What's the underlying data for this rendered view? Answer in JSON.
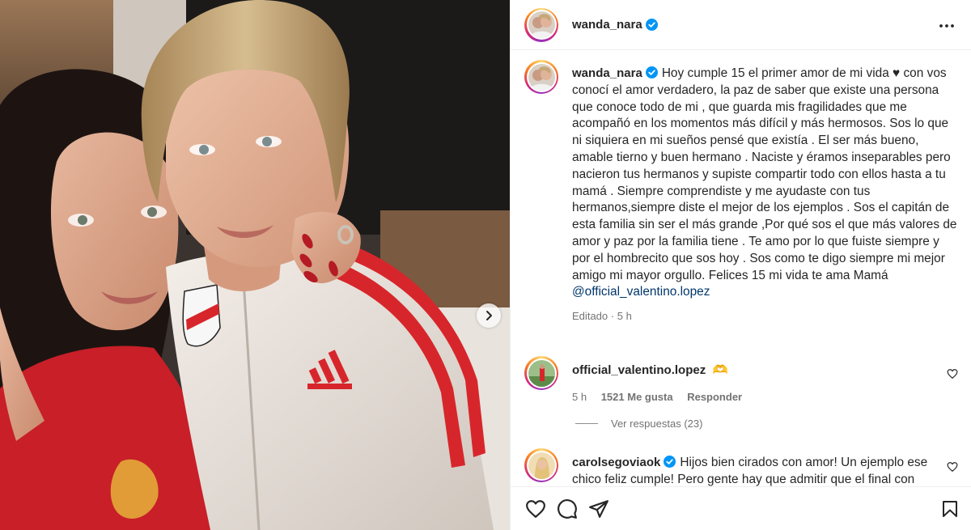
{
  "post": {
    "username": "wanda_nara",
    "caption": "Hoy cumple 15 el primer amor de mi vida ♥ con vos conocí el amor verdadero, la paz de saber que existe una persona que conoce todo de mi , que guarda mis fragilidades que me acompañó en los momentos más difícil y más hermosos. Sos lo que ni siquiera en mi sueños pensé que existía . El ser más bueno, amable tierno y buen hermano . Naciste y éramos inseparables pero nacieron tus hermanos y supiste compartir todo con ellos hasta a tu mamá . Siempre comprendiste y me ayudaste con tus hermanos,siempre diste el mejor de los ejemplos . Sos el capitán de esta familia sin ser el más grande ,Por qué sos el que más valores de amor y paz por la familia tiene . Te amo por lo que fuiste siempre y por el hombrecito que sos hoy . Sos como te digo siempre mi mejor amigo mi mayor orgullo. Felices 15 mi vida te ama Mamá",
    "mention": "@official_valentino.lopez",
    "edited": "Editado",
    "time": "5 h"
  },
  "comments": [
    {
      "username": "official_valentino.lopez",
      "text": "🫶",
      "time": "5 h",
      "likes": "1521 Me gusta",
      "reply": "Responder",
      "view_replies": "Ver respuestas (23)"
    },
    {
      "username": "carolsegoviaok",
      "text": "Hijos bien cirados con amor! Un ejemplo ese chico feliz cumple! Pero gente hay que admitir que el final con"
    }
  ],
  "colors": {
    "verified": "#0095f6",
    "mention": "#00376b",
    "secondary_text": "#737373",
    "jersey_red": "#d7262b"
  },
  "icons": [
    "verified-badge-icon",
    "more-options-icon",
    "heart-icon",
    "comment-icon",
    "share-icon",
    "bookmark-icon",
    "chevron-right-icon"
  ]
}
